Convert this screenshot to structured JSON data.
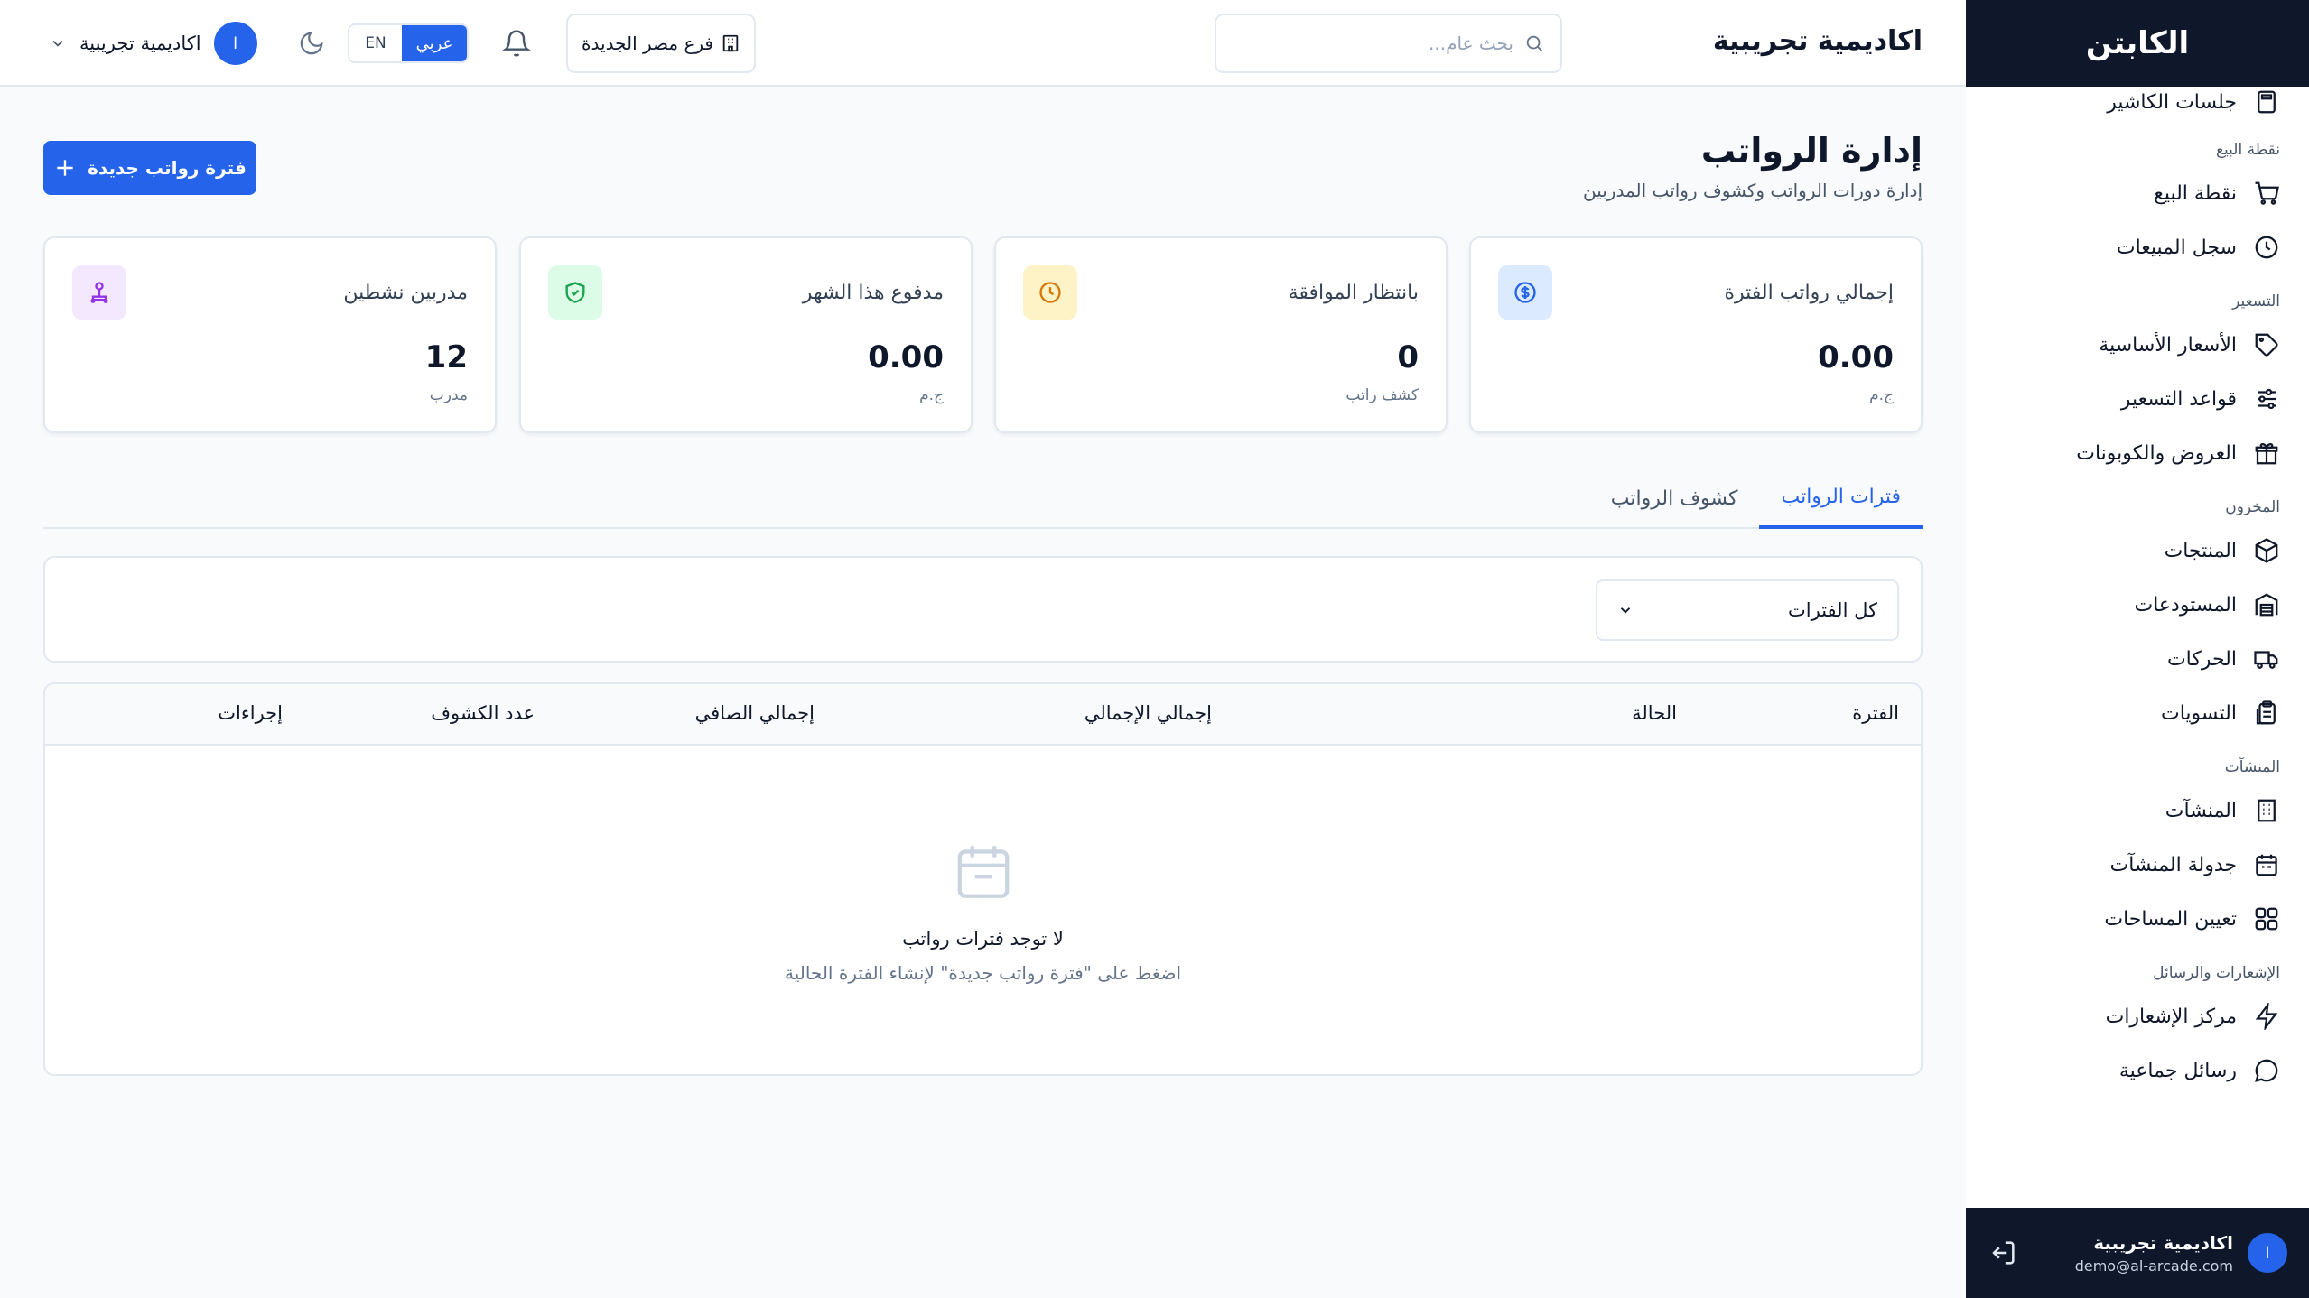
{
  "app": {
    "brand": "الكابتن",
    "academy_name": "اكاديمية تجريبية"
  },
  "topbar": {
    "search_placeholder": "بحث عام...",
    "branch_label": "فرع مصر الجديدة",
    "lang_en": "EN",
    "lang_ar": "عربي",
    "user_initial": "ا",
    "user_name": "اكاديمية تجريبية"
  },
  "sidebar": {
    "top_item": "جلسات الكاشير",
    "sections": [
      {
        "title": "نقطة البيع",
        "items": [
          {
            "label": "نقطة البيع",
            "icon": "cart-icon"
          },
          {
            "label": "سجل المبيعات",
            "icon": "clock-icon"
          }
        ]
      },
      {
        "title": "التسعير",
        "items": [
          {
            "label": "الأسعار الأساسية",
            "icon": "tag-icon"
          },
          {
            "label": "قواعد التسعير",
            "icon": "sliders-icon"
          },
          {
            "label": "العروض والكوبونات",
            "icon": "gift-icon"
          }
        ]
      },
      {
        "title": "المخزون",
        "items": [
          {
            "label": "المنتجات",
            "icon": "box-icon"
          },
          {
            "label": "المستودعات",
            "icon": "warehouse-icon"
          },
          {
            "label": "الحركات",
            "icon": "truck-icon"
          },
          {
            "label": "التسويات",
            "icon": "clipboard-icon"
          }
        ]
      },
      {
        "title": "المنشآت",
        "items": [
          {
            "label": "المنشآت",
            "icon": "building-icon"
          },
          {
            "label": "جدولة المنشآت",
            "icon": "calendar-icon"
          },
          {
            "label": "تعيين المساحات",
            "icon": "grid-icon"
          }
        ]
      },
      {
        "title": "الإشعارات والرسائل",
        "items": [
          {
            "label": "مركز الإشعارات",
            "icon": "zap-icon"
          },
          {
            "label": "رسائل جماعية",
            "icon": "message-icon"
          }
        ]
      }
    ],
    "footer": {
      "initial": "ا",
      "name": "اكاديمية تجريبية",
      "email": "demo@al-arcade.com"
    }
  },
  "page": {
    "title": "إدارة الرواتب",
    "subtitle": "إدارة دورات الرواتب وكشوف رواتب المدربين",
    "new_button": "فترة رواتب جديدة"
  },
  "stats": [
    {
      "label": "إجمالي رواتب الفترة",
      "value": "0.00",
      "unit": "ج.م",
      "icon": "dollar-icon",
      "color": "#2563eb",
      "bg": "#dbeafe"
    },
    {
      "label": "بانتظار الموافقة",
      "value": "0",
      "unit": "كشف راتب",
      "icon": "clock-icon",
      "color": "#d97706",
      "bg": "#fef3c7"
    },
    {
      "label": "مدفوع هذا الشهر",
      "value": "0.00",
      "unit": "ج.م",
      "icon": "shield-check-icon",
      "color": "#16a34a",
      "bg": "#dcfce7"
    },
    {
      "label": "مدربين نشطين",
      "value": "12",
      "unit": "مدرب",
      "icon": "users-icon",
      "color": "#9333ea",
      "bg": "#f3e8ff"
    }
  ],
  "tabs": [
    {
      "label": "فترات الرواتب",
      "active": true
    },
    {
      "label": "كشوف الرواتب",
      "active": false
    }
  ],
  "filter": {
    "selected": "كل الفترات"
  },
  "table": {
    "headers": [
      "الفترة",
      "الحالة",
      "إجمالي الإجمالي",
      "إجمالي الصافي",
      "عدد الكشوف",
      "إجراءات"
    ],
    "empty_title": "لا توجد فترات رواتب",
    "empty_desc": "اضغط على \"فترة رواتب جديدة\" لإنشاء الفترة الحالية"
  },
  "colors": {
    "primary": "#2563eb",
    "sidebar_dark": "#0f172a",
    "background": "#f8fafc"
  }
}
